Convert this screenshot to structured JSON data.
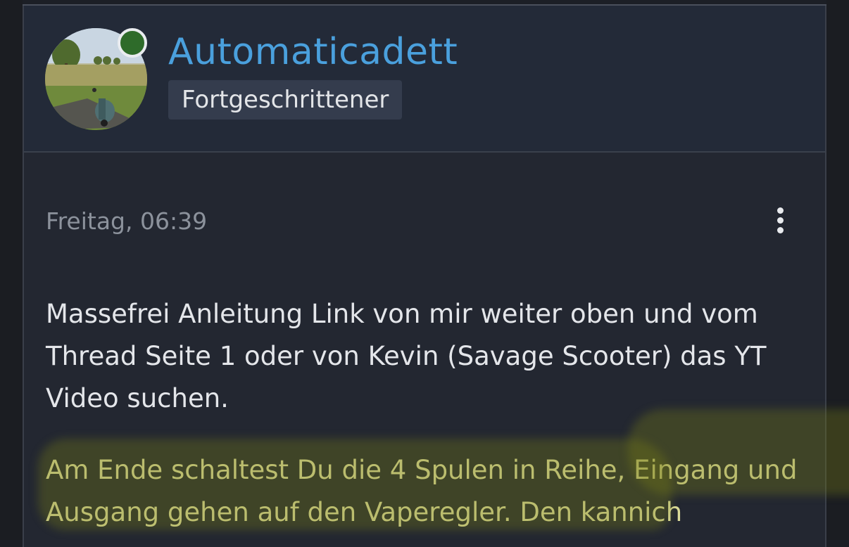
{
  "author": {
    "username": "Automaticadett",
    "rank": "Fortgeschrittener",
    "online": true
  },
  "post": {
    "timestamp": "Freitag, 06:39",
    "paragraphs": [
      "Massefrei Anleitung Link von mir weiter oben und vom Thread Seite 1 oder von Kevin (Savage Scooter) das YT Video suchen.",
      "Am Ende schaltest Du die 4 Spulen in Reihe, Eingang und Ausgang gehen auf den Vaperegler. Den kannich"
    ]
  },
  "icons": {
    "menu": "more-vertical-icon",
    "status": "online-status-icon"
  },
  "colors": {
    "username": "#4aa0dd",
    "online": "#2e6b2a",
    "highlight": "#7a8014"
  }
}
